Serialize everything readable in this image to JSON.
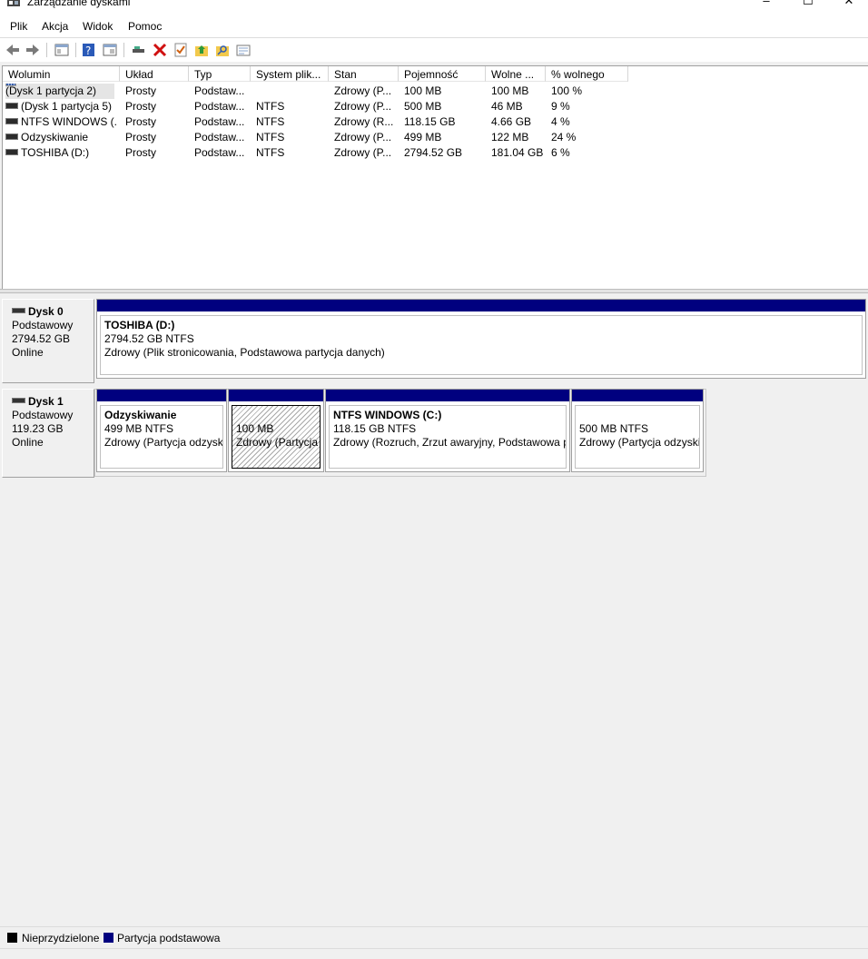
{
  "window": {
    "title": "Zarządzanie dyskami",
    "controls": {
      "minimize": "–",
      "maximize": "☐",
      "close": "✕"
    }
  },
  "menu": [
    "Plik",
    "Akcja",
    "Widok",
    "Pomoc"
  ],
  "toolbar": [
    "back-icon",
    "forward-icon",
    "console-tree-icon",
    "help-icon",
    "properties-icon",
    "connect-disk-icon",
    "delete-icon",
    "check-icon",
    "folder-up-icon",
    "search-folder-icon",
    "list-icon"
  ],
  "volumes": {
    "columns": [
      "Wolumin",
      "Układ",
      "Typ",
      "System plik...",
      "Stan",
      "Pojemność",
      "Wolne ...",
      "% wolnego"
    ],
    "rows": [
      [
        "(Dysk 1 partycja 2)",
        "Prosty",
        "Podstaw...",
        "",
        "Zdrowy (P...",
        "100 MB",
        "100 MB",
        "100 %"
      ],
      [
        "(Dysk 1 partycja 5)",
        "Prosty",
        "Podstaw...",
        "NTFS",
        "Zdrowy (P...",
        "500 MB",
        "46 MB",
        "9 %"
      ],
      [
        "NTFS WINDOWS (...",
        "Prosty",
        "Podstaw...",
        "NTFS",
        "Zdrowy (R...",
        "118.15 GB",
        "4.66 GB",
        "4 %"
      ],
      [
        "Odzyskiwanie",
        "Prosty",
        "Podstaw...",
        "NTFS",
        "Zdrowy (P...",
        "499 MB",
        "122 MB",
        "24 %"
      ],
      [
        "TOSHIBA (D:)",
        "Prosty",
        "Podstaw...",
        "NTFS",
        "Zdrowy (P...",
        "2794.52 GB",
        "181.04 GB",
        "6 %"
      ]
    ]
  },
  "disks": [
    {
      "name": "Dysk 0",
      "type": "Podstawowy",
      "size": "2794.52 GB",
      "status": "Online",
      "partitions": [
        {
          "name": "TOSHIBA  (D:)",
          "size": "2794.52 GB NTFS",
          "state": "Zdrowy (Plik stronicowania, Podstawowa partycja danych)"
        }
      ]
    },
    {
      "name": "Dysk 1",
      "type": "Podstawowy",
      "size": "119.23 GB",
      "status": "Online",
      "partitions": [
        {
          "name": "Odzyskiwanie",
          "size": "499 MB NTFS",
          "state": "Zdrowy (Partycja odzysk"
        },
        {
          "name": "",
          "size": "100 MB",
          "state": "Zdrowy (Partycja"
        },
        {
          "name": "NTFS WINDOWS  (C:)",
          "size": "118.15 GB NTFS",
          "state": "Zdrowy (Rozruch, Zrzut awaryjny, Podstawowa p"
        },
        {
          "name": "",
          "size": "500 MB NTFS",
          "state": "Zdrowy (Partycja odzyski"
        }
      ]
    }
  ],
  "legend": [
    {
      "label": "Nieprzydzielone",
      "color": "#000000"
    },
    {
      "label": "Partycja podstawowa",
      "color": "#00007f"
    }
  ]
}
